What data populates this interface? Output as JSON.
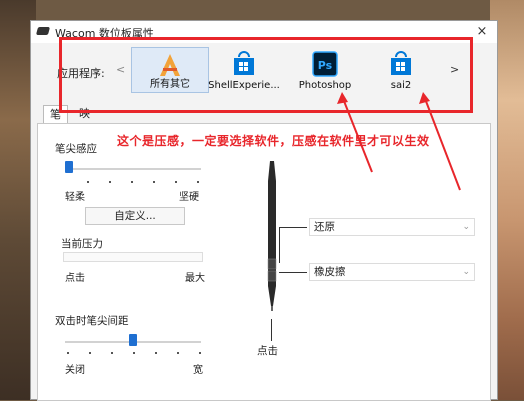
{
  "window": {
    "title": "Wacom 数位板属性",
    "close_glyph": "×"
  },
  "app_bar": {
    "label": "应用程序:",
    "nav_prev": "<",
    "nav_next": ">",
    "apps": [
      {
        "label": "所有其它",
        "icon": "all-apps-icon",
        "selected": true
      },
      {
        "label": "ShellExperie...",
        "icon": "windows-store-icon",
        "selected": false
      },
      {
        "label": "Photoshop",
        "icon": "photoshop-icon",
        "selected": false
      },
      {
        "label": "sai2",
        "icon": "windows-store-icon",
        "selected": false
      }
    ]
  },
  "tabs": [
    {
      "label": "笔",
      "active": true
    },
    {
      "label": "映射",
      "active": false
    }
  ],
  "annotation": "这个是压感，一定要选择软件，压感在软件里才可以生效",
  "pen_tip_feel": {
    "label": "笔尖感应",
    "min_label": "轻柔",
    "max_label": "坚硬",
    "level": 0.0,
    "customize_label": "自定义..."
  },
  "current_pressure": {
    "label": "当前压力",
    "min_label": "点击",
    "max_label": "最大",
    "level": 0.0
  },
  "double_click_distance": {
    "label": "双击时笔尖间距",
    "min_label": "关闭",
    "max_label": "宽",
    "level": 0.5
  },
  "pen_buttons": {
    "upper": "还原",
    "lower": "橡皮擦",
    "tip": "点击"
  },
  "colors": {
    "annotation_red": "#e8262b",
    "slider_blue": "#1f6fd1",
    "photoshop_blue": "#001e36",
    "photoshop_text": "#31a8ff",
    "store_blue": "#0078d7"
  }
}
